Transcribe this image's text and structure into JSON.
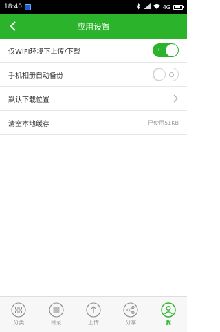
{
  "status_bar": {
    "time": "18:40",
    "network": "4G",
    "wifi_icon": "wifi-icon",
    "bluetooth_icon": "bluetooth-icon"
  },
  "header": {
    "title": "应用设置",
    "back_icon": "back-arrow-icon",
    "color": "#2bb32b"
  },
  "settings": [
    {
      "label": "仅WIFI环境下上传/下载",
      "control": "toggle",
      "state": "on",
      "toggle_mark": "I"
    },
    {
      "label": "手机相册自动备份",
      "control": "toggle",
      "state": "off"
    },
    {
      "label": "默认下载位置",
      "control": "chevron"
    },
    {
      "label": "清空本地缓存",
      "value": "已使用51KB"
    }
  ],
  "tabs": [
    {
      "label": "分类",
      "icon": "grid-icon",
      "active": false
    },
    {
      "label": "目录",
      "icon": "list-icon",
      "active": false
    },
    {
      "label": "上传",
      "icon": "upload-icon",
      "active": false
    },
    {
      "label": "分享",
      "icon": "share-icon",
      "active": false
    },
    {
      "label": "我",
      "icon": "person-icon",
      "active": true
    }
  ]
}
